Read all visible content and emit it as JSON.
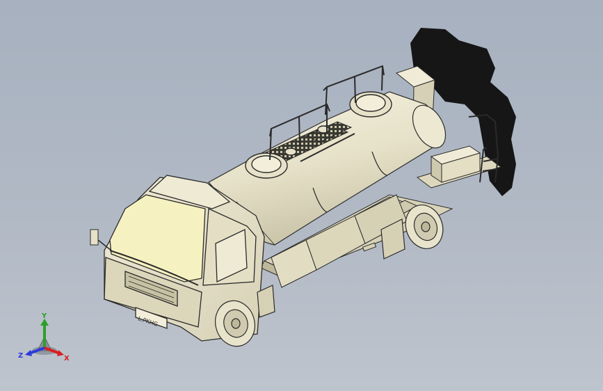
{
  "viewport": {
    "background_top": "#a7b1bf",
    "background_bottom": "#bec4cd"
  },
  "model": {
    "body_color": "#eae6cf",
    "cab_window_color": "#f6f1c0",
    "shadow_color": "#161616",
    "outline_color": "#2a2a2a",
    "plate_text": "L.PKHG"
  },
  "triad": {
    "x_label": "X",
    "y_label": "Y",
    "z_label": "Z",
    "x_color": "#d92020",
    "y_color": "#2aa02a",
    "z_color": "#2c3bd9"
  }
}
